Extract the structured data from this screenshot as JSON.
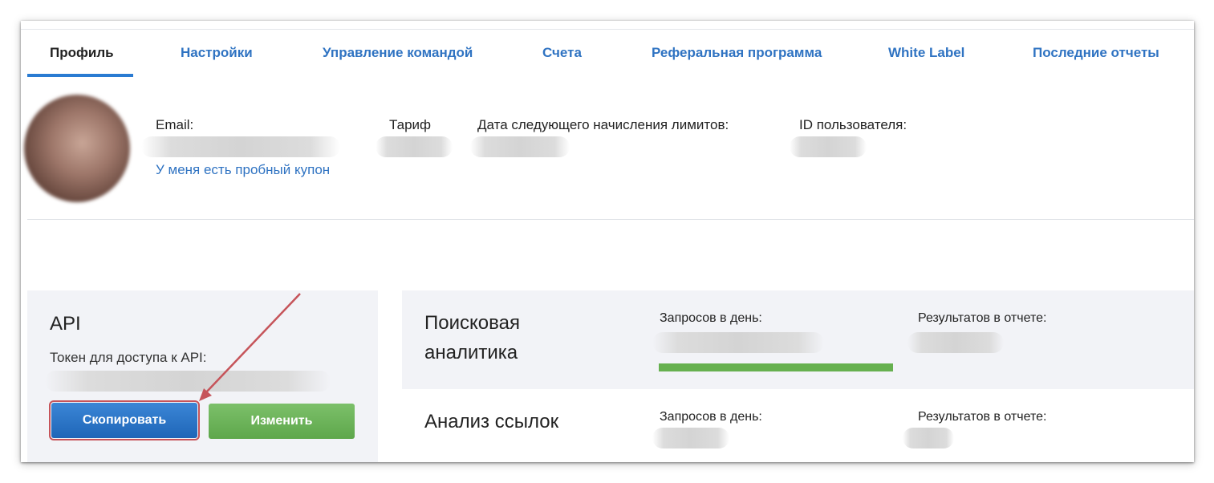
{
  "tabs": [
    {
      "label": "Профиль",
      "active": true
    },
    {
      "label": "Настройки",
      "active": false
    },
    {
      "label": "Управление командой",
      "active": false
    },
    {
      "label": "Счета",
      "active": false
    },
    {
      "label": "Реферальная программа",
      "active": false
    },
    {
      "label": "White Label",
      "active": false
    },
    {
      "label": "Последние отчеты",
      "active": false
    }
  ],
  "profile": {
    "email_label": "Email:",
    "tariff_label": "Тариф",
    "next_limits_label": "Дата следующего начисления лимитов:",
    "user_id_label": "ID пользователя:",
    "coupon_link": "У меня есть пробный купон"
  },
  "api": {
    "title": "API",
    "token_label": "Токен для доступа к API:",
    "copy_button": "Скопировать",
    "edit_button": "Изменить"
  },
  "search_analytics": {
    "title_line1": "Поисковая",
    "title_line2": "аналитика",
    "requests_label": "Запросов в день:",
    "results_label": "Результатов в отчете:",
    "progress_fraction": 1.0
  },
  "link_analysis": {
    "title": "Анализ ссылок",
    "requests_label": "Запросов в день:",
    "results_label": "Результатов в отчете:"
  },
  "colors": {
    "link": "#2f73c2",
    "tab_underline": "#2a7bd2",
    "copy_button": "#2a73c4",
    "edit_button": "#6db55b",
    "progress": "#66b04f",
    "arrow": "#c6545a"
  }
}
